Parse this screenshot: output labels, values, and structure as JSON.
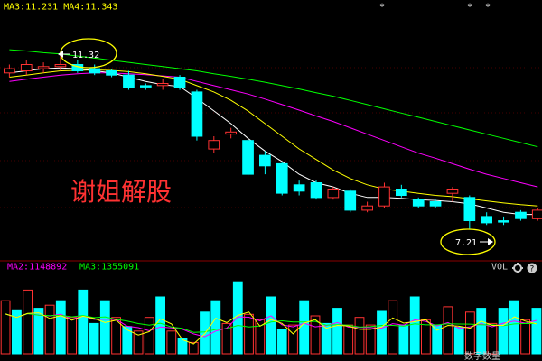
{
  "header": {
    "ma_text": "MA3:11.231  MA4:11.343",
    "markers": [
      "*",
      "*",
      "*"
    ]
  },
  "watermark": "谢姐解股",
  "annotations": {
    "high_label": "11.32",
    "low_label": "7.21"
  },
  "volume_header": {
    "ma2": "MA2:1148892",
    "ma3": "MA3:1355091",
    "vol": "VOL"
  },
  "footer": {
    "label": "数字数量"
  },
  "colors": {
    "up": "#ff3232",
    "down": "#00ffff",
    "ma5": "#ffffff",
    "ma10": "#ffff00",
    "ma20": "#ff00ff",
    "ma30": "#00ff00",
    "annotation": "#ffff00",
    "ma2": "#ff00ff",
    "ma3": "#00ff00",
    "grid": "#8b0000"
  },
  "chart_data": [
    {
      "type": "candlestick",
      "ylim": [
        6.6,
        12.2
      ],
      "candles": [
        {
          "o": 10.9,
          "c": 11.0,
          "h": 11.1,
          "l": 10.8
        },
        {
          "o": 10.95,
          "c": 11.1,
          "h": 11.2,
          "l": 10.85
        },
        {
          "o": 11.0,
          "c": 11.05,
          "h": 11.15,
          "l": 10.9
        },
        {
          "o": 11.05,
          "c": 11.1,
          "h": 11.32,
          "l": 10.95
        },
        {
          "o": 11.1,
          "c": 10.95,
          "h": 11.2,
          "l": 10.9
        },
        {
          "o": 11.0,
          "c": 10.9,
          "h": 11.1,
          "l": 10.85
        },
        {
          "o": 10.95,
          "c": 10.85,
          "h": 11.0,
          "l": 10.8
        },
        {
          "o": 10.85,
          "c": 10.55,
          "h": 10.95,
          "l": 10.5
        },
        {
          "o": 10.6,
          "c": 10.58,
          "h": 10.65,
          "l": 10.5
        },
        {
          "o": 10.6,
          "c": 10.65,
          "h": 10.75,
          "l": 10.5
        },
        {
          "o": 10.8,
          "c": 10.55,
          "h": 10.85,
          "l": 10.5
        },
        {
          "o": 10.45,
          "c": 9.4,
          "h": 10.5,
          "l": 9.3
        },
        {
          "o": 9.1,
          "c": 9.3,
          "h": 9.4,
          "l": 9.0
        },
        {
          "o": 9.45,
          "c": 9.5,
          "h": 9.6,
          "l": 9.35
        },
        {
          "o": 9.3,
          "c": 8.5,
          "h": 9.35,
          "l": 8.45
        },
        {
          "o": 8.95,
          "c": 8.7,
          "h": 9.05,
          "l": 8.5
        },
        {
          "o": 8.75,
          "c": 8.05,
          "h": 8.8,
          "l": 8.0
        },
        {
          "o": 8.25,
          "c": 8.1,
          "h": 8.35,
          "l": 8.0
        },
        {
          "o": 8.3,
          "c": 7.95,
          "h": 8.35,
          "l": 7.9
        },
        {
          "o": 7.95,
          "c": 8.15,
          "h": 8.2,
          "l": 7.9
        },
        {
          "o": 8.1,
          "c": 7.65,
          "h": 8.15,
          "l": 7.6
        },
        {
          "o": 7.65,
          "c": 7.75,
          "h": 7.85,
          "l": 7.6
        },
        {
          "o": 7.75,
          "c": 8.2,
          "h": 8.3,
          "l": 7.7
        },
        {
          "o": 8.15,
          "c": 8.0,
          "h": 8.25,
          "l": 7.95
        },
        {
          "o": 7.9,
          "c": 7.75,
          "h": 7.95,
          "l": 7.7
        },
        {
          "o": 7.85,
          "c": 7.75,
          "h": 7.9,
          "l": 7.7
        },
        {
          "o": 8.05,
          "c": 8.15,
          "h": 8.2,
          "l": 7.85
        },
        {
          "o": 7.95,
          "c": 7.4,
          "h": 8.0,
          "l": 7.21
        },
        {
          "o": 7.5,
          "c": 7.35,
          "h": 7.6,
          "l": 7.3
        },
        {
          "o": 7.4,
          "c": 7.38,
          "h": 7.5,
          "l": 7.3
        },
        {
          "o": 7.6,
          "c": 7.45,
          "h": 7.65,
          "l": 7.4
        },
        {
          "o": 7.45,
          "c": 7.65,
          "h": 7.7,
          "l": 7.4
        }
      ],
      "ma5": [
        10.9,
        10.95,
        11.0,
        11.02,
        11.0,
        10.95,
        10.9,
        10.8,
        10.7,
        10.62,
        10.58,
        10.3,
        10.0,
        9.7,
        9.35,
        9.05,
        8.8,
        8.5,
        8.3,
        8.2,
        8.05,
        7.95,
        7.95,
        7.93,
        7.9,
        7.88,
        7.85,
        7.8,
        7.7,
        7.6,
        7.55,
        7.55
      ],
      "ma10": [
        10.8,
        10.85,
        10.9,
        10.95,
        10.96,
        10.97,
        10.96,
        10.93,
        10.88,
        10.82,
        10.75,
        10.6,
        10.45,
        10.25,
        10.0,
        9.7,
        9.4,
        9.1,
        8.85,
        8.6,
        8.4,
        8.25,
        8.15,
        8.1,
        8.05,
        8.0,
        7.97,
        7.92,
        7.87,
        7.82,
        7.78,
        7.75
      ],
      "ma20": [
        10.7,
        10.75,
        10.8,
        10.85,
        10.88,
        10.9,
        10.9,
        10.88,
        10.86,
        10.83,
        10.8,
        10.7,
        10.6,
        10.5,
        10.4,
        10.28,
        10.15,
        10.02,
        9.88,
        9.75,
        9.6,
        9.45,
        9.3,
        9.15,
        9.0,
        8.88,
        8.75,
        8.62,
        8.5,
        8.4,
        8.3,
        8.2
      ],
      "ma30": [
        11.45,
        11.42,
        11.38,
        11.35,
        11.3,
        11.25,
        11.2,
        11.15,
        11.1,
        11.05,
        11.0,
        10.95,
        10.88,
        10.82,
        10.75,
        10.68,
        10.6,
        10.52,
        10.43,
        10.35,
        10.25,
        10.15,
        10.05,
        9.95,
        9.85,
        9.75,
        9.65,
        9.55,
        9.45,
        9.35,
        9.25,
        9.15
      ]
    },
    {
      "type": "bar",
      "series_name": "VOL",
      "ylim": [
        0,
        100
      ],
      "values": [
        70,
        58,
        84,
        60,
        64,
        70,
        48,
        84,
        40,
        70,
        48,
        36,
        30,
        48,
        75,
        30,
        20,
        15,
        55,
        70,
        40,
        95,
        52,
        45,
        75,
        32,
        38,
        70,
        50,
        40,
        60,
        38,
        48,
        38,
        56,
        70,
        38,
        75,
        45,
        38,
        62,
        35,
        55,
        60,
        40,
        60,
        70,
        45,
        60
      ],
      "up": [
        1,
        0,
        1,
        0,
        1,
        0,
        1,
        0,
        0,
        0,
        1,
        0,
        1,
        1,
        0,
        1,
        0,
        1,
        0,
        0,
        1,
        0,
        1,
        1,
        0,
        0,
        1,
        0,
        1,
        0,
        0,
        1,
        1,
        1,
        0,
        1,
        0,
        0,
        1,
        0,
        1,
        0,
        1,
        0,
        1,
        0,
        0,
        1,
        0
      ]
    }
  ]
}
